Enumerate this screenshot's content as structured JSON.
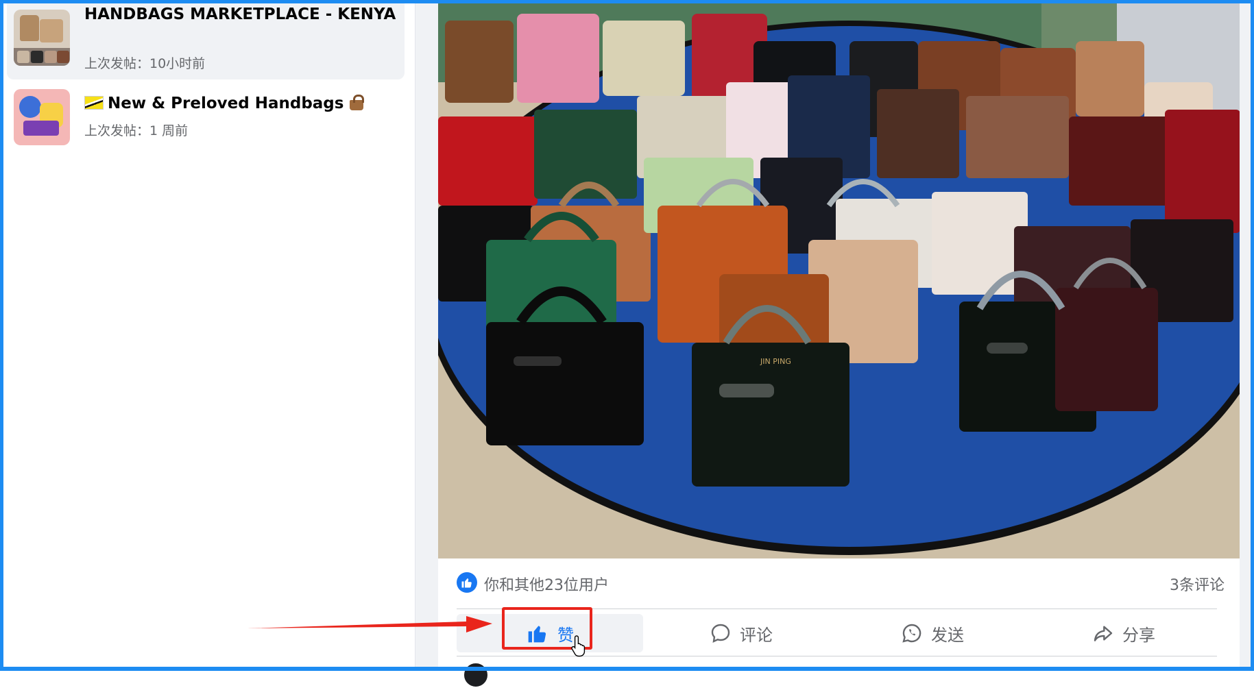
{
  "sidebar": {
    "groups": [
      {
        "title": "HANDBAGS MARKETPLACE - KENYA",
        "last_post": "上次发帖：10小时前",
        "thumbnail": "handbags-photo-collage"
      },
      {
        "title": "New & Preloved Handbags",
        "last_post": "上次发帖：1 周前",
        "thumbnail": "colorful-illustration",
        "leading_icon": "brunei-flag-icon",
        "trailing_icon": "handbag-icon"
      }
    ]
  },
  "post": {
    "photo_label": "JIN PING",
    "reactions": {
      "text": "你和其他23位用户",
      "icon": "like-reaction-icon",
      "comment_count": "3条评论"
    },
    "actions": [
      {
        "label": "赞",
        "icon": "thumbs-up-icon",
        "state": "liked"
      },
      {
        "label": "评论",
        "icon": "comment-bubble-icon"
      },
      {
        "label": "发送",
        "icon": "whatsapp-icon"
      },
      {
        "label": "分享",
        "icon": "share-arrow-icon"
      }
    ]
  },
  "annotation": {
    "highlight_color": "#e9251c",
    "pointer": "red-arrow-pointing-to-like-button"
  },
  "colors": {
    "facebook_blue": "#1877f2",
    "screen_border": "#1d8cf2",
    "secondary_text": "#65676b",
    "mat_blue": "#1f4fa6"
  }
}
